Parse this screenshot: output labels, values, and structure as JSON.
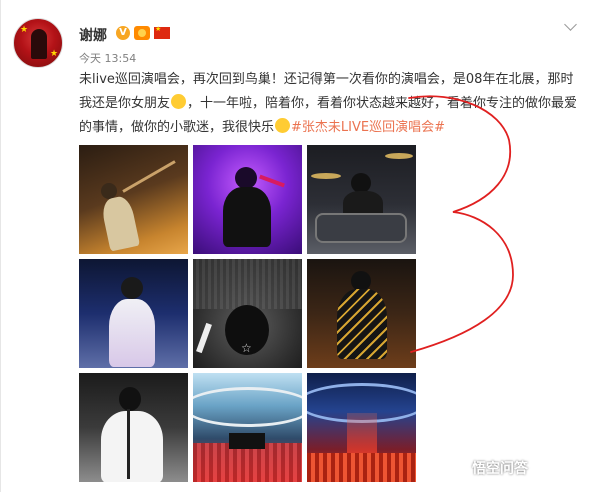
{
  "post": {
    "author_name": "谢娜",
    "timestamp": "今天 13:54",
    "badge_v": "V",
    "text_part1": "未live巡回演唱会，再次回到鸟巢！还记得第一次看你的演唱会，是08年在北展，那时我还是你女朋友",
    "text_part2": "，十一年啦，陪着你，看着你状态越来越好，看着你专注的做你最爱的事情，做你的小歌迷，我很快乐",
    "hashtag": "#张杰未LIVE巡回演唱会#"
  },
  "watermark": {
    "text": "悟空问答"
  },
  "icons": [
    "avatar",
    "verified-v-icon",
    "member-badge-icon",
    "china-flag-icon",
    "chevron-down-icon",
    "wink-emoji-icon",
    "smile-emoji-icon",
    "wukong-logo-icon"
  ],
  "colors": {
    "hashtag": "#eb7350",
    "annotation_red": "#e02020",
    "verified": "#f7a623"
  }
}
